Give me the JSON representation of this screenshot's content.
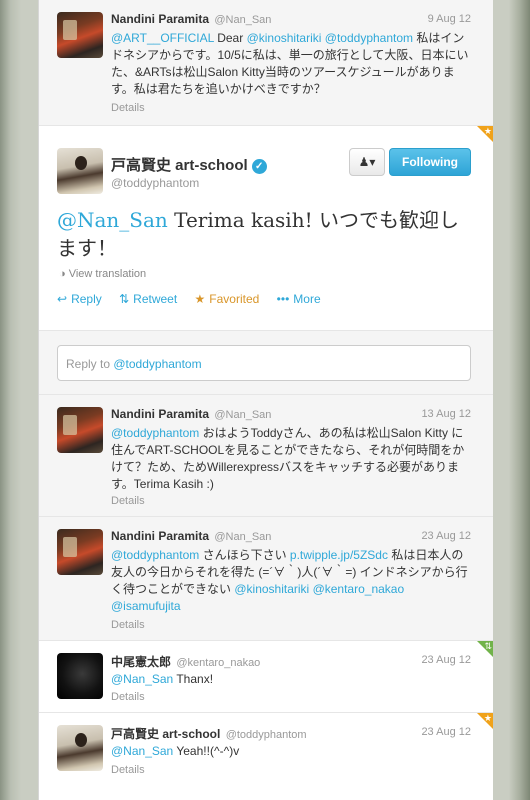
{
  "tweets": [
    {
      "name": "Nandini Paramita",
      "handle": "@Nan_San",
      "date": "9 Aug 12",
      "text_parts": [
        {
          "t": "@ART__OFFICIAL",
          "link": true
        },
        {
          "t": " Dear ",
          "link": false
        },
        {
          "t": "@kinoshitariki",
          "link": true
        },
        {
          "t": " ",
          "link": false
        },
        {
          "t": "@toddyphantom",
          "link": true
        },
        {
          "t": " 私はインドネシアからです。10/5に私は、単一の旅行として大阪、日本にいた、&ARTsは松山Salon Kitty当時のツアースケジュールがあります。私は君たちを追いかけべきですか？",
          "link": false
        }
      ],
      "details": "Details"
    },
    {
      "name": "Nandini Paramita",
      "handle": "@Nan_San",
      "date": "13 Aug 12",
      "text_parts": [
        {
          "t": "@toddyphantom",
          "link": true
        },
        {
          "t": " おはようToddyさん、あの私は松山Salon Kitty に住んでART-SCHOOLを見ることができたなら、それが何時間をかけて？ため、ためWillerexpressバスをキャッチする必要があります。Terima Kasih :)",
          "link": false
        }
      ],
      "details": "Details"
    },
    {
      "name": "Nandini Paramita",
      "handle": "@Nan_San",
      "date": "23 Aug 12",
      "text_parts": [
        {
          "t": "@toddyphantom",
          "link": true
        },
        {
          "t": " さんほら下さい ",
          "link": false
        },
        {
          "t": "p.twipple.jp/5ZSdc",
          "link": true
        },
        {
          "t": " 私は日本人の友人の今日からそれを得た (=´∀｀)人(´∀｀=) インドネシアから行く待つことができない ",
          "link": false
        },
        {
          "t": "@kinoshitariki",
          "link": true
        },
        {
          "t": " ",
          "link": false
        },
        {
          "t": "@kentaro_nakao",
          "link": true
        },
        {
          "t": " ",
          "link": false
        },
        {
          "t": "@isamufujita",
          "link": true
        }
      ],
      "details": "Details"
    },
    {
      "name": "中尾憲太郎",
      "handle": "@kentaro_nakao",
      "date": "23 Aug 12",
      "text_parts": [
        {
          "t": "@Nan_San",
          "link": true
        },
        {
          "t": " Thanx!",
          "link": false
        }
      ],
      "details": "Details"
    },
    {
      "name": "戸高賢史 art-school",
      "handle": "@toddyphantom",
      "date": "23 Aug 12",
      "text_parts": [
        {
          "t": "@Nan_San",
          "link": true
        },
        {
          "t": " Yeah!!(^-^)v",
          "link": false
        }
      ],
      "details": "Details"
    }
  ],
  "main_tweet": {
    "name": "戸高賢史 art-school",
    "handle": "@toddyphantom",
    "mention": "@Nan_San",
    "text": " Terima kasih! いつでも歓迎します！",
    "view_translation": "View translation",
    "follow_label": "Following",
    "actions": {
      "reply": "Reply",
      "retweet": "Retweet",
      "favorited": "Favorited",
      "more": "More"
    }
  },
  "reply_box": {
    "prefix": "Reply to ",
    "handle": "@toddyphantom"
  },
  "colors": {
    "link": "#2fa8d8",
    "favorite": "#d9962a",
    "following_button": "#2ea4d6",
    "favorite_corner": "#f0a21a",
    "retweet_corner": "#71b34a"
  },
  "icons": {
    "verified": "verified-badge-icon",
    "user_dropdown": "user-dropdown-icon",
    "globe": "globe-icon",
    "reply": "reply-icon",
    "retweet": "retweet-icon",
    "favorite": "star-icon",
    "more": "more-dots-icon"
  }
}
